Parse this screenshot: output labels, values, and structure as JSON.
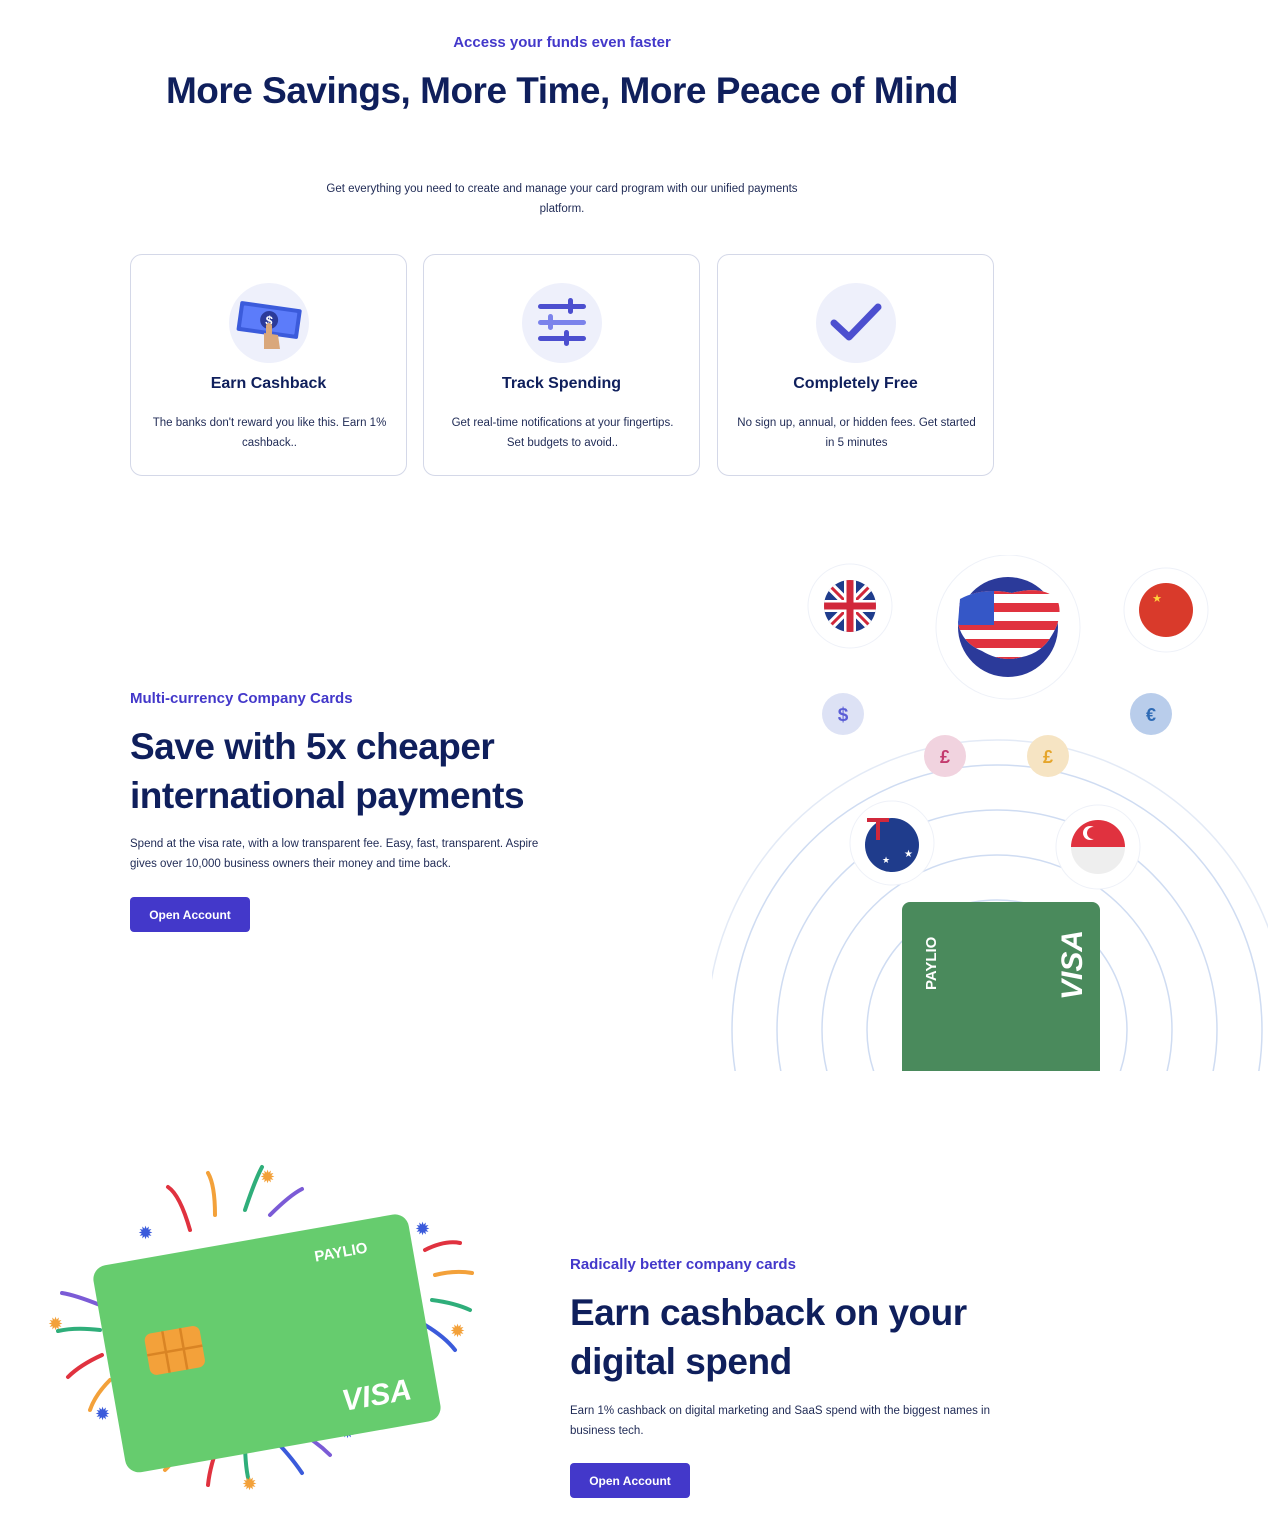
{
  "intro": {
    "eyebrow": "Access your funds even faster",
    "title": "More Savings, More Time, More Peace of Mind",
    "description": "Get everything you need to create and manage your card program with our unified payments platform."
  },
  "features": [
    {
      "icon": "cashback-money-icon",
      "title": "Earn Cashback",
      "description": "The banks don't reward you like this. Earn 1% cashback.."
    },
    {
      "icon": "sliders-icon",
      "title": "Track Spending",
      "description": "Get real-time notifications at your fingertips. Set budgets to avoid.."
    },
    {
      "icon": "checkmark-icon",
      "title": "Completely Free",
      "description": "No sign up, annual, or hidden fees. Get started in 5 minutes"
    }
  ],
  "multicurrency": {
    "eyebrow": "Multi-currency Company Cards",
    "title": "Save with 5x cheaper international payments",
    "description": "Spend at the visa rate, with a low transparent fee. Easy, fast, transparent. Aspire gives over 10,000 business owners their money and time back.",
    "button_label": "Open Account",
    "currency_symbols": [
      "$",
      "€",
      "£",
      "£"
    ],
    "card_brand": "PAYLIO",
    "card_network": "VISA",
    "colors": {
      "card": "#4a8a5c",
      "usd": "#5b5fd6",
      "eur": "#2f6bb5",
      "gbp_pink": "#c33b6e",
      "gbp_gold": "#e5a52a"
    }
  },
  "cashback": {
    "eyebrow": "Radically better company cards",
    "title": "Earn cashback on your digital spend",
    "description": "Earn 1% cashback on digital marketing and SaaS spend with the biggest names in business tech.",
    "button_label": "Open Account",
    "card_brand": "PAYLIO",
    "card_network": "VISA",
    "colors": {
      "card": "#66cc6e",
      "chip": "#f3a13a"
    }
  },
  "colors": {
    "accent": "#4338ca",
    "heading": "#0f1f5c",
    "card_border": "#d4d8e8",
    "icon_bg": "#eef0fb"
  }
}
